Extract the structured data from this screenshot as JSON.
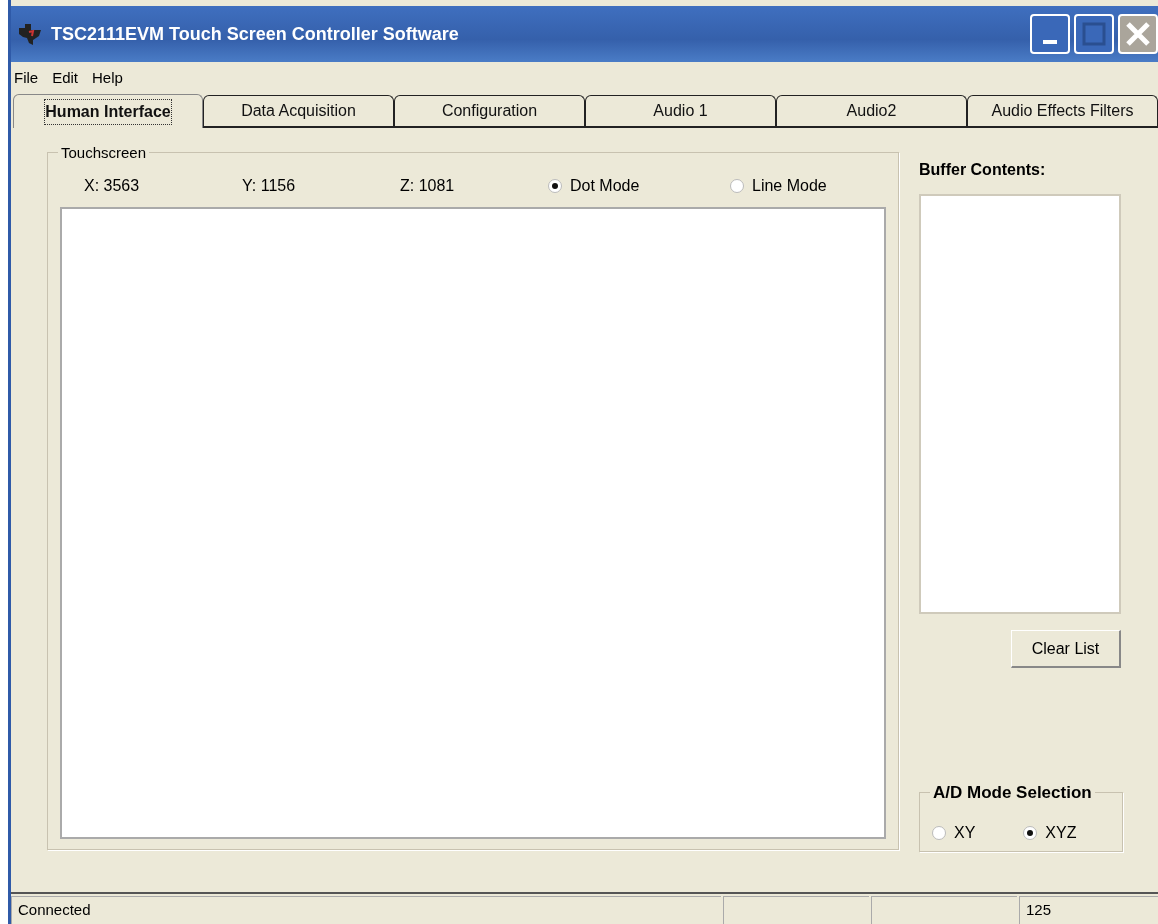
{
  "window": {
    "title": "TSC2111EVM Touch Screen Controller Software"
  },
  "menu": [
    "File",
    "Edit",
    "Help"
  ],
  "tabs": [
    {
      "label": "Human Interface",
      "selected": true
    },
    {
      "label": "Data Acquisition",
      "selected": false
    },
    {
      "label": "Configuration",
      "selected": false
    },
    {
      "label": "Audio 1",
      "selected": false
    },
    {
      "label": "Audio2",
      "selected": false
    },
    {
      "label": "Audio Effects Filters",
      "selected": false
    }
  ],
  "touchscreen": {
    "title": "Touchscreen",
    "readouts": [
      "X: 3563",
      "Y: 1156",
      "Z: 1081"
    ],
    "modes": [
      {
        "label": "Dot Mode",
        "selected": true
      },
      {
        "label": "Line Mode",
        "selected": false
      }
    ]
  },
  "buffer": {
    "label": "Buffer Contents:",
    "clear_button": "Clear List"
  },
  "ad_mode": {
    "title": "A/D Mode Selection",
    "options": [
      {
        "label": "XY",
        "selected": false
      },
      {
        "label": "XYZ",
        "selected": true
      }
    ]
  },
  "status_bar": {
    "text": "Connected",
    "value": "125"
  }
}
